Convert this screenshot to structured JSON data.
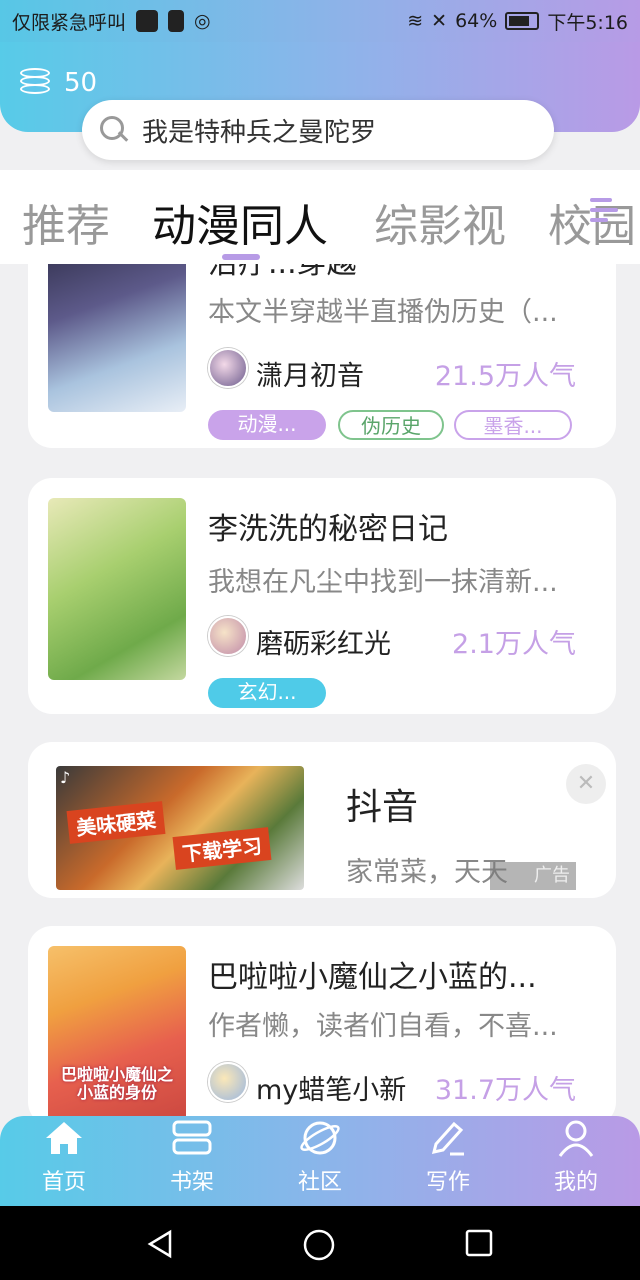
{
  "status": {
    "carrier_text": "仅限紧急呼叫",
    "battery": "64%",
    "time": "下午5:16"
  },
  "header": {
    "coin_count": "50",
    "search_text": "我是特种兵之曼陀罗"
  },
  "tabs": [
    {
      "label": "推荐"
    },
    {
      "label": "动漫同人"
    },
    {
      "label": "综影视"
    },
    {
      "label": "校园"
    }
  ],
  "books": [
    {
      "title": "治疗...穿越",
      "desc": "本文半穿越半直播伪历史（...",
      "author": "潇月初音",
      "popularity": "21.5万人气",
      "tags": [
        "动漫...",
        "伪历史",
        "墨香..."
      ]
    },
    {
      "title": "李洗洗的秘密日记",
      "desc": "我想在凡尘中找到一抹清新...",
      "author": "磨砺彩红光",
      "popularity": "2.1万人气",
      "tags": [
        "玄幻..."
      ]
    },
    {
      "title": "巴啦啦小魔仙之小蓝的...",
      "desc": "作者懒，读者们自看，不喜...",
      "author": "my蜡笔小新",
      "popularity": "31.7万人气",
      "cover_text": "巴啦啦小魔仙之小蓝的身份",
      "tags": []
    }
  ],
  "ad": {
    "title": "抖音",
    "desc": "家常菜，天天",
    "badge": "广告",
    "image_text_1": "美味硬菜",
    "image_text_2": "下载学习",
    "close": "✕"
  },
  "bottom_nav": [
    {
      "label": "首页",
      "icon": "home-icon"
    },
    {
      "label": "书架",
      "icon": "bookshelf-icon"
    },
    {
      "label": "社区",
      "icon": "planet-icon"
    },
    {
      "label": "写作",
      "icon": "pen-icon"
    },
    {
      "label": "我的",
      "icon": "person-icon"
    }
  ],
  "colors": {
    "accent_start": "#57cbe8",
    "accent_end": "#b99ae6",
    "popularity": "#c5a0e6"
  }
}
